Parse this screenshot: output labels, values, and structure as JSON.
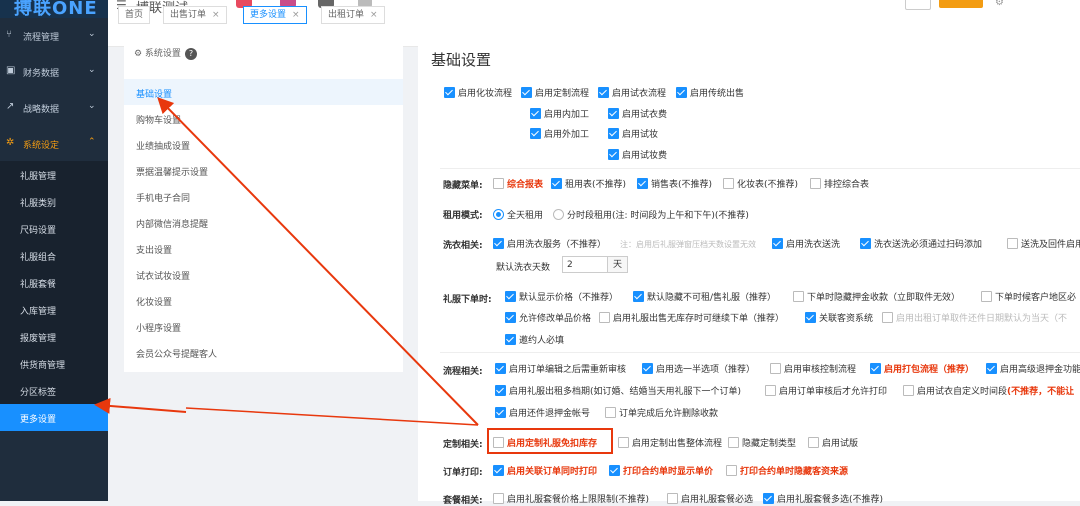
{
  "app": {
    "logo": "搏联ONE",
    "brand": "博联测试"
  },
  "colors": {
    "accent": "#1890ff",
    "sidebar_bg": "#1f2d3d",
    "active_menu": "#f39c12",
    "highlight_red": "#e8380d"
  },
  "sidebar": {
    "groups": [
      {
        "icon": "flow-icon",
        "glyph": "⑂",
        "label": "流程管理"
      },
      {
        "icon": "finance-icon",
        "glyph": "▣",
        "label": "财务数据"
      },
      {
        "icon": "chart-icon",
        "glyph": "↗",
        "label": "战略数据"
      },
      {
        "icon": "gear-icon",
        "glyph": "✲",
        "label": "系统设定"
      }
    ],
    "subitems": [
      "礼服管理",
      "礼服类别",
      "尺码设置",
      "礼服组合",
      "礼服套餐",
      "入库管理",
      "报废管理",
      "供货商管理",
      "分区标签",
      "更多设置"
    ]
  },
  "tabs": [
    {
      "label": "首页"
    },
    {
      "label": "出售订单"
    },
    {
      "label": "更多设置"
    },
    {
      "label": "出租订单"
    }
  ],
  "settings_nav": {
    "header": "⚙ 系统设置",
    "items": [
      "基础设置",
      "购物车设置",
      "业绩抽成设置",
      "票据温馨提示设置",
      "手机电子合同",
      "内部微信消息提醒",
      "支出设置",
      "试衣试妆设置",
      "化妆设置",
      "小程序设置",
      "会员公众号提醒客人"
    ]
  },
  "main": {
    "title": "基础设置",
    "top_options": [
      "启用化妆流程",
      "启用定制流程",
      "启用试衣流程",
      "启用传统出售",
      "启用内加工",
      "启用试衣费",
      "启用外加工",
      "启用试妆",
      "启用试妆费"
    ],
    "hidden_menu": {
      "label": "隐藏菜单:",
      "opts": [
        "综合报表",
        "租用表(不推荐)",
        "销售表(不推荐)",
        "化妆表(不推荐)",
        "排控综合表"
      ]
    },
    "rent_mode": {
      "label": "租用模式:",
      "opts": [
        "全天租用",
        "分时段租用(注: 时间段为上午和下午)(不推荐)"
      ]
    },
    "laundry": {
      "label": "洗衣相关:",
      "opts": [
        "启用洗衣服务（不推荐）",
        "启用洗衣送洗",
        "洗衣送洗必须通过扫码添加",
        "送洗及回件启用"
      ],
      "hint": "注：启用后礼服弹窗压档天数设置无效",
      "days_label": "默认洗衣天数",
      "days_value": "2",
      "days_unit": "天"
    },
    "order": {
      "label": "礼服下单时:",
      "opts": [
        "默认显示价格（不推荐）",
        "默认隐藏不可租/售礼服（推荐）",
        "下单时隐藏押金收款（立即取件无效）",
        "下单时候客户地区必",
        "允许修改单品价格",
        "启用礼服出售无库存时可继续下单（推荐）",
        "关联客资系统",
        "启用出租订单取件还件日期默认为当天（不",
        "邀约人必填"
      ]
    },
    "flow": {
      "label": "流程相关:",
      "opts": [
        "启用订单编辑之后需重新审核",
        "启用选一半选项（推荐）",
        "启用审核控制流程",
        "启用打包流程（推荐）",
        "启用高级退押金功能",
        "启用礼服出租多档期(如订婚、结婚当天用礼服下一个订单)",
        "启用订单审核后才允许打印",
        "启用试衣自定义时间段",
        "(不推荐，不能让",
        "启用还件退押金帐号",
        "订单完成后允许删除收款"
      ]
    },
    "custom": {
      "label": "定制相关:",
      "opts": [
        "启用定制礼服免扣库存",
        "启用定制出售整体流程",
        "隐藏定制类型",
        "启用试版"
      ]
    },
    "print": {
      "label": "订单打印:",
      "opts": [
        "启用关联订单同时打印",
        "打印合约单时显示单价",
        "打印合约单时隐藏客资来源"
      ]
    },
    "package": {
      "label": "套餐相关:",
      "opts": [
        "启用礼服套餐价格上限限制(不推荐)",
        "启用礼服套餐必选",
        "启用礼服套餐多选(不推荐)"
      ]
    }
  }
}
